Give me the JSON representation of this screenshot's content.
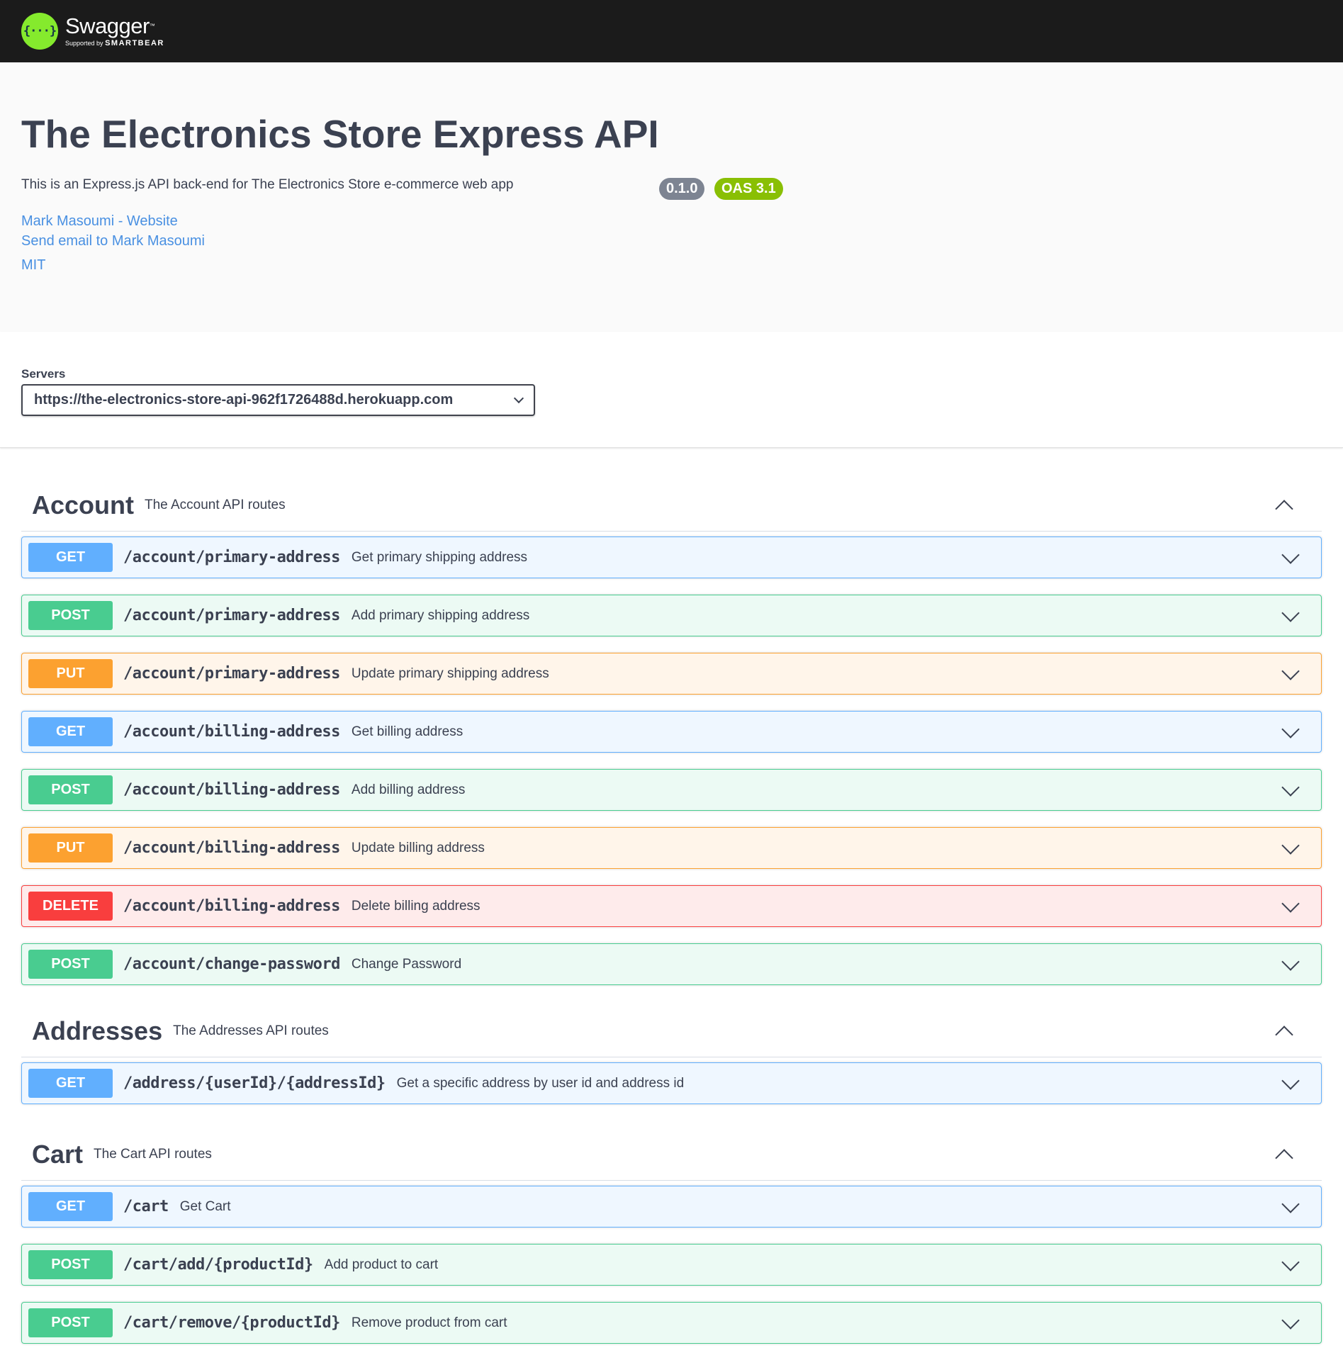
{
  "header": {
    "logo_glyph": "{···}",
    "logo_word": "Swagger",
    "logo_tm": "™",
    "logo_supported": "Supported by",
    "logo_brand": "SMARTBEAR"
  },
  "info": {
    "title": "The Electronics Store Express API",
    "version": "0.1.0",
    "oas": "OAS 3.1",
    "description": "This is an Express.js API back-end for The Electronics Store e-commerce web app",
    "contact_website": "Mark Masoumi - Website",
    "contact_email": "Send email to Mark Masoumi",
    "license": "MIT"
  },
  "servers": {
    "label": "Servers",
    "selected": "https://the-electronics-store-api-962f1726488d.herokuapp.com"
  },
  "tags": [
    {
      "name": "Account",
      "description": "The Account API routes",
      "operations": [
        {
          "method": "GET",
          "path": "/account/primary-address",
          "summary": "Get primary shipping address"
        },
        {
          "method": "POST",
          "path": "/account/primary-address",
          "summary": "Add primary shipping address"
        },
        {
          "method": "PUT",
          "path": "/account/primary-address",
          "summary": "Update primary shipping address"
        },
        {
          "method": "GET",
          "path": "/account/billing-address",
          "summary": "Get billing address"
        },
        {
          "method": "POST",
          "path": "/account/billing-address",
          "summary": "Add billing address"
        },
        {
          "method": "PUT",
          "path": "/account/billing-address",
          "summary": "Update billing address"
        },
        {
          "method": "DELETE",
          "path": "/account/billing-address",
          "summary": "Delete billing address"
        },
        {
          "method": "POST",
          "path": "/account/change-password",
          "summary": "Change Password"
        }
      ]
    },
    {
      "name": "Addresses",
      "description": "The Addresses API routes",
      "operations": [
        {
          "method": "GET",
          "path": "/address/{userId}/{addressId}",
          "summary": "Get a specific address by user id and address id"
        }
      ]
    },
    {
      "name": "Cart",
      "description": "The Cart API routes",
      "operations": [
        {
          "method": "GET",
          "path": "/cart",
          "summary": "Get Cart"
        },
        {
          "method": "POST",
          "path": "/cart/add/{productId}",
          "summary": "Add product to cart"
        },
        {
          "method": "POST",
          "path": "/cart/remove/{productId}",
          "summary": "Remove product from cart"
        }
      ]
    }
  ],
  "colors": {
    "topbar": "#1b1b1b",
    "logo_green": "#85ea2d",
    "get": "#61affe",
    "post": "#49cc90",
    "put": "#fca130",
    "delete": "#f93e3e",
    "link": "#4990e2"
  },
  "icons": {
    "server_select": "chevron-down-icon",
    "tag_toggle": "chevron-up-icon",
    "operation_toggle": "chevron-down-icon"
  }
}
